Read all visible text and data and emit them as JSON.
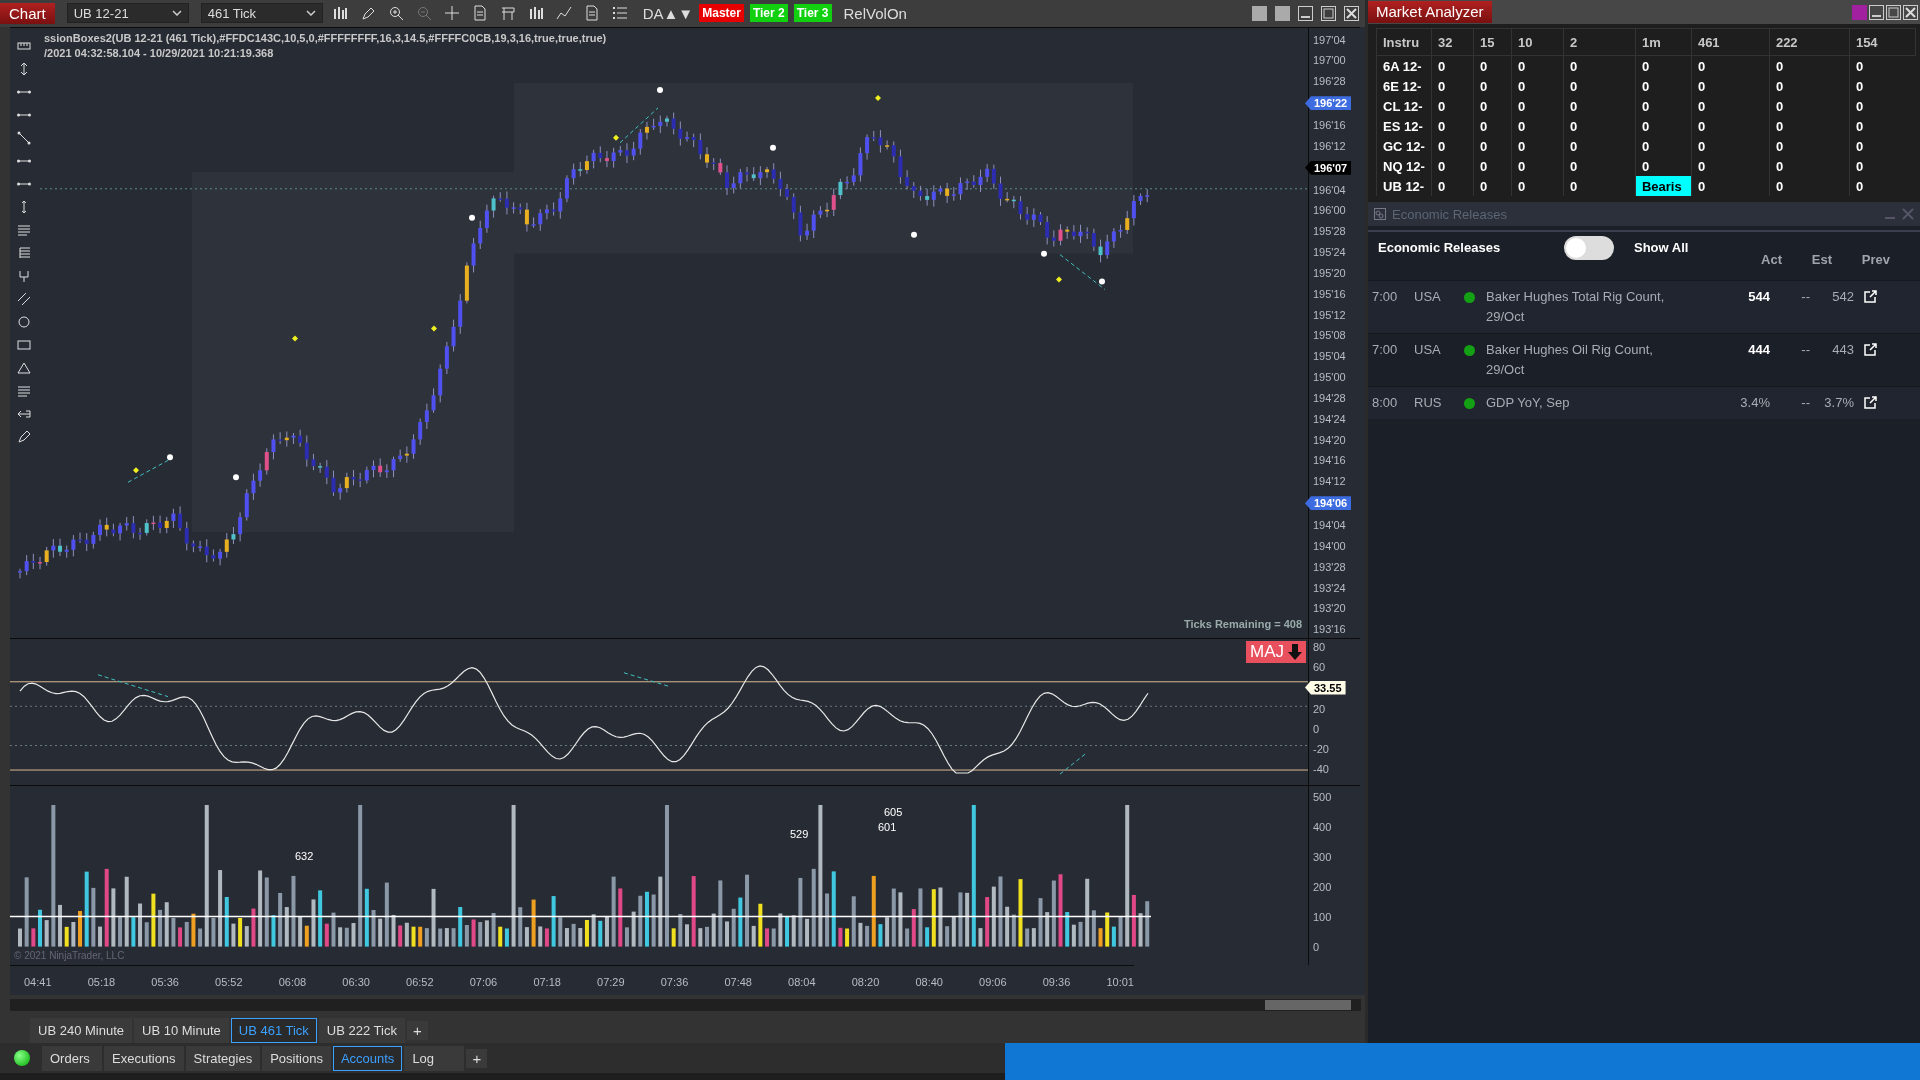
{
  "chart_window": {
    "title": "Chart",
    "instrument": "UB 12-21",
    "period": "461 Tick",
    "toolbar_text": "DA▲▼",
    "badges": [
      {
        "label": "Master",
        "color": "#e80000"
      },
      {
        "label": "Tier 2",
        "color": "#10d010"
      },
      {
        "label": "Tier 3",
        "color": "#10d010"
      }
    ],
    "relvol": "RelVolOn",
    "indicator_text": "ssionBoxes2(UB 12-21 (461 Tick),#FFDC143C,10,5,0,#FFFFFFFF,16,3,14.5,#FFFFC0CB,19,3,16,true,true,true)",
    "range_text": "/2021 04:32:58.104 - 10/29/2021 10:21:19.368",
    "ticks_remaining": "Ticks Remaining = 408",
    "price_axis": [
      {
        "kind": "tick",
        "label": "197'04"
      },
      {
        "kind": "tick",
        "label": "197'00"
      },
      {
        "kind": "tick",
        "label": "196'28"
      },
      {
        "kind": "marker",
        "label": "196'22",
        "color": "#3d6be0"
      },
      {
        "kind": "tick",
        "label": "196'16"
      },
      {
        "kind": "tick",
        "label": "196'12"
      },
      {
        "kind": "marker",
        "label": "196'07",
        "color": "#000000"
      },
      {
        "kind": "tick",
        "label": "196'04"
      },
      {
        "kind": "tick",
        "label": "196'00"
      },
      {
        "kind": "tick",
        "label": "195'28"
      },
      {
        "kind": "tick",
        "label": "195'24"
      },
      {
        "kind": "tick",
        "label": "195'20"
      },
      {
        "kind": "tick",
        "label": "195'16"
      },
      {
        "kind": "tick",
        "label": "195'12"
      },
      {
        "kind": "tick",
        "label": "195'08"
      },
      {
        "kind": "tick",
        "label": "195'04"
      },
      {
        "kind": "tick",
        "label": "195'00"
      },
      {
        "kind": "tick",
        "label": "194'28"
      },
      {
        "kind": "tick",
        "label": "194'24"
      },
      {
        "kind": "tick",
        "label": "194'20"
      },
      {
        "kind": "tick",
        "label": "194'16"
      },
      {
        "kind": "tick",
        "label": "194'12"
      },
      {
        "kind": "marker",
        "label": "194'06",
        "color": "#3d6be0"
      },
      {
        "kind": "tick",
        "label": "194'04"
      },
      {
        "kind": "tick",
        "label": "194'00"
      },
      {
        "kind": "tick",
        "label": "193'28"
      },
      {
        "kind": "tick",
        "label": "193'24"
      },
      {
        "kind": "tick",
        "label": "193'20"
      },
      {
        "kind": "tick",
        "label": "193'16"
      }
    ],
    "oscillator": {
      "badge": "MAJ",
      "axis": [
        {
          "kind": "tick",
          "label": "80"
        },
        {
          "kind": "tick",
          "label": "60"
        },
        {
          "kind": "marker",
          "label": "33.55",
          "color": "#fffde8"
        },
        {
          "kind": "tick",
          "label": "20"
        },
        {
          "kind": "tick",
          "label": "0"
        },
        {
          "kind": "tick",
          "label": "-20"
        },
        {
          "kind": "tick",
          "label": "-40"
        }
      ]
    },
    "volume": {
      "labels": [
        "632",
        "529",
        "605",
        "601"
      ],
      "copyright": "© 2021 NinjaTrader, LLC",
      "axis": [
        {
          "kind": "tick",
          "label": "500"
        },
        {
          "kind": "tick",
          "label": "400"
        },
        {
          "kind": "tick",
          "label": "300"
        },
        {
          "kind": "tick",
          "label": "200"
        },
        {
          "kind": "tick",
          "label": "100"
        },
        {
          "kind": "tick",
          "label": "0"
        }
      ]
    },
    "time_axis": [
      "04:41",
      "05:18",
      "05:36",
      "05:52",
      "06:08",
      "06:30",
      "06:52",
      "07:06",
      "07:18",
      "07:29",
      "07:36",
      "07:48",
      "08:04",
      "08:20",
      "08:40",
      "09:06",
      "09:36",
      "10:01"
    ],
    "chart_tabs": [
      {
        "label": "UB 240 Minute",
        "selected": false
      },
      {
        "label": "UB 10 Minute",
        "selected": false
      },
      {
        "label": "UB 461 Tick",
        "selected": true
      },
      {
        "label": "UB 222 Tick",
        "selected": false
      }
    ],
    "add_tab": "+"
  },
  "market_analyzer": {
    "title": "Market Analyzer",
    "columns": [
      "Instru",
      "32",
      "15",
      "10",
      "2",
      "1m",
      "461",
      "222",
      "154"
    ],
    "rows": [
      {
        "cells": [
          "6A 12-",
          "0",
          "0",
          "0",
          "0",
          "0",
          "0",
          "0",
          "0"
        ]
      },
      {
        "cells": [
          "6E 12-",
          "0",
          "0",
          "0",
          "0",
          "0",
          "0",
          "0",
          "0"
        ]
      },
      {
        "cells": [
          "CL 12-",
          "0",
          "0",
          "0",
          "0",
          "0",
          "0",
          "0",
          "0"
        ]
      },
      {
        "cells": [
          "ES 12-",
          "0",
          "0",
          "0",
          "0",
          "0",
          "0",
          "0",
          "0"
        ]
      },
      {
        "cells": [
          "GC 12-",
          "0",
          "0",
          "0",
          "0",
          "0",
          "0",
          "0",
          "0"
        ]
      },
      {
        "cells": [
          "NQ 12-",
          "0",
          "0",
          "0",
          "0",
          "0",
          "0",
          "0",
          "0"
        ]
      },
      {
        "cells": [
          "UB 12-",
          "0",
          "0",
          "0",
          "0",
          {
            "text": "Bearis",
            "color": "#00ffff"
          },
          "0",
          "0",
          "0"
        ]
      }
    ]
  },
  "economic_releases": {
    "window_title": "Economic Releases",
    "heading": "Economic Releases",
    "show_all": {
      "label": "Show All",
      "on": false
    },
    "columns": [
      "Act",
      "Est",
      "Prev"
    ],
    "rows": [
      {
        "time": "7:00",
        "country": "USA",
        "color": "#14a014",
        "event": "Baker Hughes Total Rig Count, 29/Oct",
        "act": "544",
        "act_emphasis": true,
        "est": "--",
        "prev": "542"
      },
      {
        "time": "7:00",
        "country": "USA",
        "color": "#14a014",
        "event": "Baker Hughes Oil Rig Count, 29/Oct",
        "act": "444",
        "act_emphasis": true,
        "est": "--",
        "prev": "443"
      },
      {
        "time": "8:00",
        "country": "RUS",
        "color": "#14a014",
        "event": "GDP YoY, Sep",
        "act": "3.4%",
        "act_emphasis": false,
        "est": "--",
        "prev": "3.7%"
      }
    ]
  },
  "bottom_bar": {
    "connected": true,
    "tabs": [
      {
        "label": "Orders",
        "selected": false
      },
      {
        "label": "Executions",
        "selected": false
      },
      {
        "label": "Strategies",
        "selected": false
      },
      {
        "label": "Positions",
        "selected": false
      },
      {
        "label": "Accounts",
        "selected": true
      },
      {
        "label": "Log",
        "selected": false
      }
    ],
    "add_tab": "+"
  }
}
